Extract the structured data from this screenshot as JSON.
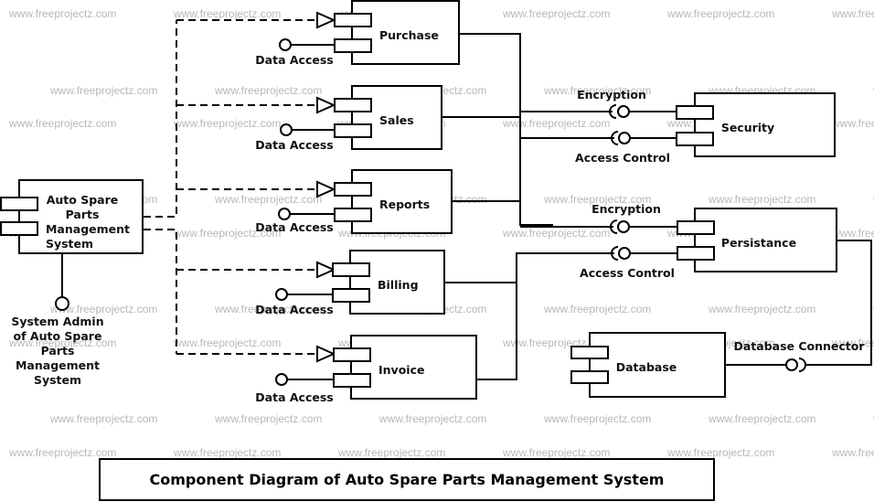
{
  "watermark": "www.freeprojectz.com",
  "title": "Component Diagram of Auto Spare Parts Management System",
  "main_component": {
    "label_lines": [
      "Auto Spare",
      "Parts",
      "Management",
      "System"
    ]
  },
  "actor_interface": {
    "label_lines": [
      "System Admin",
      "of Auto Spare",
      "Parts",
      "Management",
      "System"
    ]
  },
  "modules": [
    {
      "name": "Purchase",
      "interface": "Data Access"
    },
    {
      "name": "Sales",
      "interface": "Data Access"
    },
    {
      "name": "Reports",
      "interface": "Data Access"
    },
    {
      "name": "Billing",
      "interface": "Data Access"
    },
    {
      "name": "Invoice",
      "interface": "Data Access"
    }
  ],
  "security": {
    "name": "Security",
    "interfaces": [
      "Encryption",
      "Access Control"
    ]
  },
  "persistance": {
    "name": "Persistance",
    "interfaces": [
      "Encryption",
      "Access Control"
    ]
  },
  "database": {
    "name": "Database",
    "interface": "Database Connector"
  }
}
